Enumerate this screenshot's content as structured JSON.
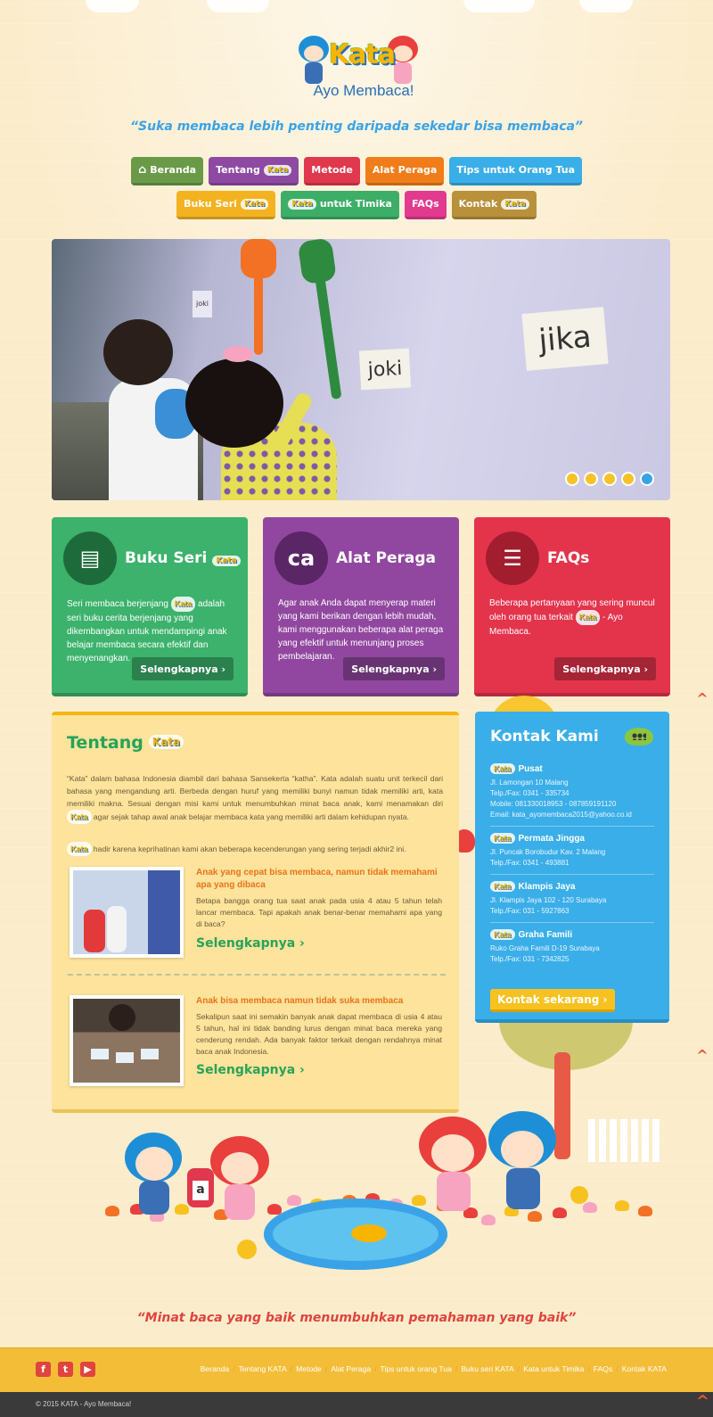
{
  "header": {
    "logo_text": "Kata",
    "logo_sub": "Ayo Membaca!",
    "tagline": "“Suka membaca lebih penting daripada sekedar bisa membaca”"
  },
  "nav": {
    "row1": [
      {
        "label": "Beranda",
        "color": "#6a9a48",
        "icon": "home-icon"
      },
      {
        "label": "Tentang",
        "color": "#8e4aa3",
        "kata": true
      },
      {
        "label": "Metode",
        "color": "#e0384d"
      },
      {
        "label": "Alat Peraga",
        "color": "#f07d19"
      },
      {
        "label": "Tips untuk Orang Tua",
        "color": "#3aaee8"
      }
    ],
    "row2": [
      {
        "label": "Buku Seri",
        "color": "#f3b321",
        "kata": true
      },
      {
        "label": "untuk Timika",
        "color": "#3dae67",
        "kata_first": true
      },
      {
        "label": "FAQs",
        "color": "#e23a8f"
      },
      {
        "label": "Kontak",
        "color": "#b8913a",
        "kata": true
      }
    ],
    "kata_badge": "Kata"
  },
  "slider": {
    "card_large": "jika",
    "card_mid": "joki",
    "card_small": "joki",
    "dots": 5,
    "active_dot": 4
  },
  "features": [
    {
      "title": "Buku Seri",
      "kata": true,
      "color": "#3cb26c",
      "icon_bg": "#1d6b3a",
      "icon": "book-icon",
      "text_pre": "Seri membaca berjenjang",
      "text_post": "adalah seri buku cerita berjenjang yang dikembangkan untuk mendampingi anak belajar membaca secara efektif dan menyenangkan.",
      "button": "Selengkapnya ›"
    },
    {
      "title": "Alat Peraga",
      "color": "#91479f",
      "icon_bg": "#5a2666",
      "icon": "letter-blocks-icon",
      "text_pre": "Agar anak Anda dapat menyerap materi yang kami berikan dengan lebih mudah, kami menggunakan beberapa alat peraga yang efektif untuk menunjang proses pembelajaran.",
      "button": "Selengkapnya ›"
    },
    {
      "title": "FAQs",
      "color": "#e3344c",
      "icon_bg": "#a21d2e",
      "icon": "chat-bubbles-icon",
      "text_pre": "Beberapa pertanyaan yang sering muncul oleh orang tua terkait",
      "text_post": "- Ayo Membaca.",
      "button": "Selengkapnya ›"
    }
  ],
  "about": {
    "title": "Tentang",
    "p1": "“Kata” dalam bahasa Indonesia diambil dari bahasa Sansekerta “katha”. Kata adalah suatu unit terkecil dari bahasa yang mengandung arti. Berbeda dengan huruf yang memiliki bunyi namun tidak memiliki arti, kata memiliki makna. Sesuai dengan misi kami untuk menumbuhkan minat baca anak, kami menamakan diri",
    "p1_post": "agar sejak tahap awal anak belajar membaca kata yang memiliki arti dalam kehidupan nyata.",
    "p2": "hadir karena keprihatinan kami akan beberapa kecenderungan yang sering terjadi akhir2 ini.",
    "articles": [
      {
        "title": "Anak yang cepat bisa membaca, namun tidak memahami apa yang dibaca",
        "text": "Betapa bangga orang tua saat anak pada usia 4 atau 5 tahun telah lancar membaca. Tapi apakah anak benar-benar memahami apa yang di baca?",
        "more": "Selengkapnya ›"
      },
      {
        "title": "Anak bisa membaca namun tidak suka membaca",
        "text": "Sekalipun saat ini semakin banyak anak dapat membaca di usia 4 atau 5 tahun, hal ini tidak banding lurus dengan minat baca mereka yang cenderung rendah. Ada banyak faktor terkait dengan rendahnya minat baca anak Indonesia.",
        "more": "Selengkapnya ›"
      }
    ]
  },
  "contact": {
    "title": "Kontak Kami",
    "offices": [
      {
        "name": "Pusat",
        "lines": [
          "Jl. Lamongan 10 Malang",
          "Telp./Fax: 0341 - 335734",
          "Mobile: 081330018953 - 087859191120",
          "Email: kata_ayomembaca2015@yahoo.co.id"
        ]
      },
      {
        "name": "Permata Jingga",
        "lines": [
          "Jl. Puncak Borobudur Kav. 2 Malang",
          "Telp./Fax: 0341 - 493881"
        ]
      },
      {
        "name": "Klampis Jaya",
        "lines": [
          "Jl. Klampis Jaya 102 - 120 Surabaya",
          "Telp./Fax: 031 - 5927863"
        ]
      },
      {
        "name": "Graha Famili",
        "lines": [
          "Ruko Graha Famili D-19 Surabaya",
          "Telp./Fax: 031 - 7342825"
        ]
      }
    ],
    "button": "Kontak sekarang ›"
  },
  "scenery": {
    "block_letter": "a"
  },
  "bottom_quote": "“Minat baca yang baik menumbuhkan pemahaman yang baik”",
  "footer": {
    "social": [
      {
        "icon": "facebook-icon",
        "glyph": "f"
      },
      {
        "icon": "twitter-icon",
        "glyph": "t"
      },
      {
        "icon": "youtube-icon",
        "glyph": "▶"
      }
    ],
    "links": [
      "Beranda",
      "Tentang KATA",
      "Metode",
      "Alat Peraga",
      "Tips untuk orang Tua",
      "Buku seri KATA",
      "Kata untuk Timika",
      "FAQs",
      "Kontak KATA"
    ],
    "copyright": "© 2015 KATA - Ayo Membaca!"
  }
}
